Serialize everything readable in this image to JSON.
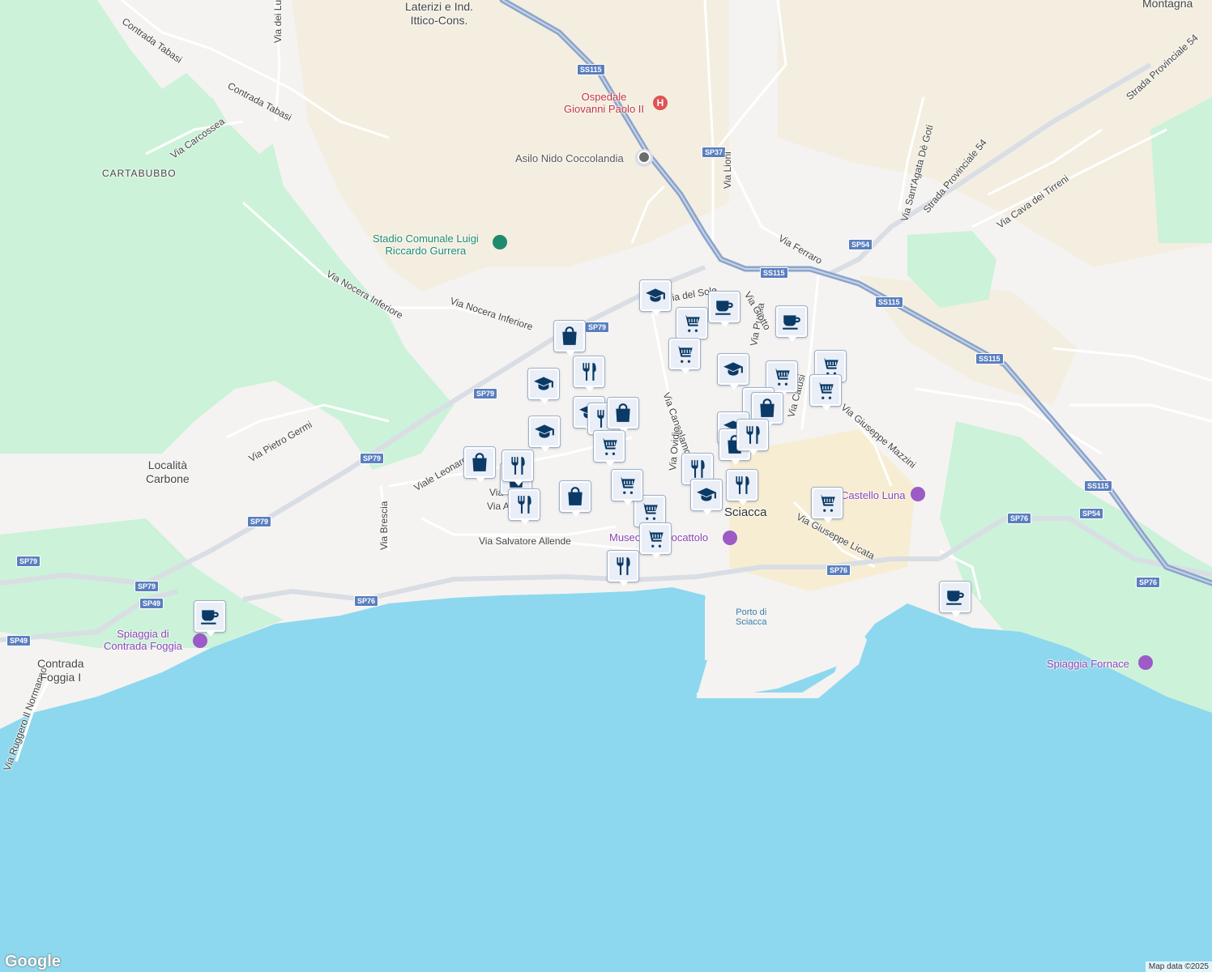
{
  "colors": {
    "sea": "#8dd8ee",
    "land": "#f4f3f1",
    "park": "#ccf2d9",
    "urban": "#f5f0e4",
    "road": "#ffffff",
    "highway": "#8ba4cc",
    "marker_bg": "#e9eef7",
    "icon": "#0b3a66"
  },
  "town": "Sciacca",
  "localities": {
    "cartabubbo": "CARTABUBBO",
    "carbone": "Località\nCarbone",
    "foggia": "Contrada\nFoggia I",
    "laterizi": "Laterizi e Ind.\nIttico-Cons.",
    "montagna": "Montagna"
  },
  "pois": {
    "ospedale": "Ospedale\nGiovanni Paolo II",
    "asilo": "Asilo Nido Coccolandia",
    "stadio": "Stadio Comunale Luigi\nRiccardo Gurrera",
    "spiaggia_foggia": "Spiaggia di\nContrada Foggia",
    "spiaggia_fornace": "Spiaggia Fornace",
    "castello": "Castello Luna",
    "museo": "Museo del Giocattolo",
    "porto": "Porto di\nSciacca"
  },
  "streets": {
    "tabasi1": "Contrada Tabasi",
    "tabasi2": "Contrada Tabasi",
    "carcossea": "Via Carcossea",
    "nocera1": "Via Nocera Inferiore",
    "nocera2": "Via Nocera Inferiore",
    "germi": "Via Pietro Germi",
    "leonardo": "Viale Leonardo",
    "galilee": "Via Galilee",
    "antonio": "Via Antonio",
    "allende": "Via Salvatore Allende",
    "brescia": "Via Brescia",
    "normanno": "Via Ruggero Il Normanno",
    "lioni": "Via Lioni",
    "ferraro": "Via Ferraro",
    "agata": "Via Sant'Agata Dè Goti",
    "prov54a": "Strada Provinciale 54",
    "prov54b": "Strada Provinciale 54",
    "tirreni": "Via Cava dei Tirreni",
    "cansalamone": "Via Cansalamone",
    "mazzini": "Via Giuseppe Mazzini",
    "licata": "Via Giuseppe Licata",
    "puglia": "Via Puglia",
    "giotto": "Via Giotto",
    "catusi": "Via Catusi",
    "sole": "Via del Sole",
    "ovidio": "Via Ovidio",
    "luni": "Via dei Luni"
  },
  "shields": {
    "ss115a": "SS115",
    "ss115b": "SS115",
    "ss115c": "SS115",
    "ss115d": "SS115",
    "ss115e": "SS115",
    "sp37": "SP37",
    "sp54a": "SP54",
    "sp54b": "SP54",
    "sp79a": "SP79",
    "sp79b": "SP79",
    "sp79c": "SP79",
    "sp79d": "SP79",
    "sp79e": "SP79",
    "sp79f": "SP79",
    "sp49a": "SP49",
    "sp49b": "SP49",
    "sp76a": "SP76",
    "sp76b": "SP76",
    "sp76c": "SP76",
    "sp76d": "SP76"
  },
  "markers": [
    {
      "t": "education"
    },
    {
      "t": "grocery"
    },
    {
      "t": "cafe"
    },
    {
      "t": "cafe"
    },
    {
      "t": "grocery"
    },
    {
      "t": "shopping"
    },
    {
      "t": "restaurant"
    },
    {
      "t": "education"
    },
    {
      "t": "education"
    },
    {
      "t": "education"
    },
    {
      "t": "restaurant"
    },
    {
      "t": "shopping"
    },
    {
      "t": "grocery"
    },
    {
      "t": "education"
    },
    {
      "t": "grocery"
    },
    {
      "t": "grocery"
    },
    {
      "t": "grocery"
    },
    {
      "t": "shopping"
    },
    {
      "t": "education"
    },
    {
      "t": "shopping"
    },
    {
      "t": "shopping"
    },
    {
      "t": "restaurant"
    },
    {
      "t": "shopping"
    },
    {
      "t": "shopping"
    },
    {
      "t": "restaurant"
    },
    {
      "t": "restaurant"
    },
    {
      "t": "shopping"
    },
    {
      "t": "grocery"
    },
    {
      "t": "restaurant"
    },
    {
      "t": "education"
    },
    {
      "t": "restaurant"
    },
    {
      "t": "grocery"
    },
    {
      "t": "grocery"
    },
    {
      "t": "restaurant"
    },
    {
      "t": "grocery"
    },
    {
      "t": "cafe"
    },
    {
      "t": "cafe"
    }
  ],
  "footer": {
    "logo": "Google",
    "attribution": "Map data ©2025"
  }
}
